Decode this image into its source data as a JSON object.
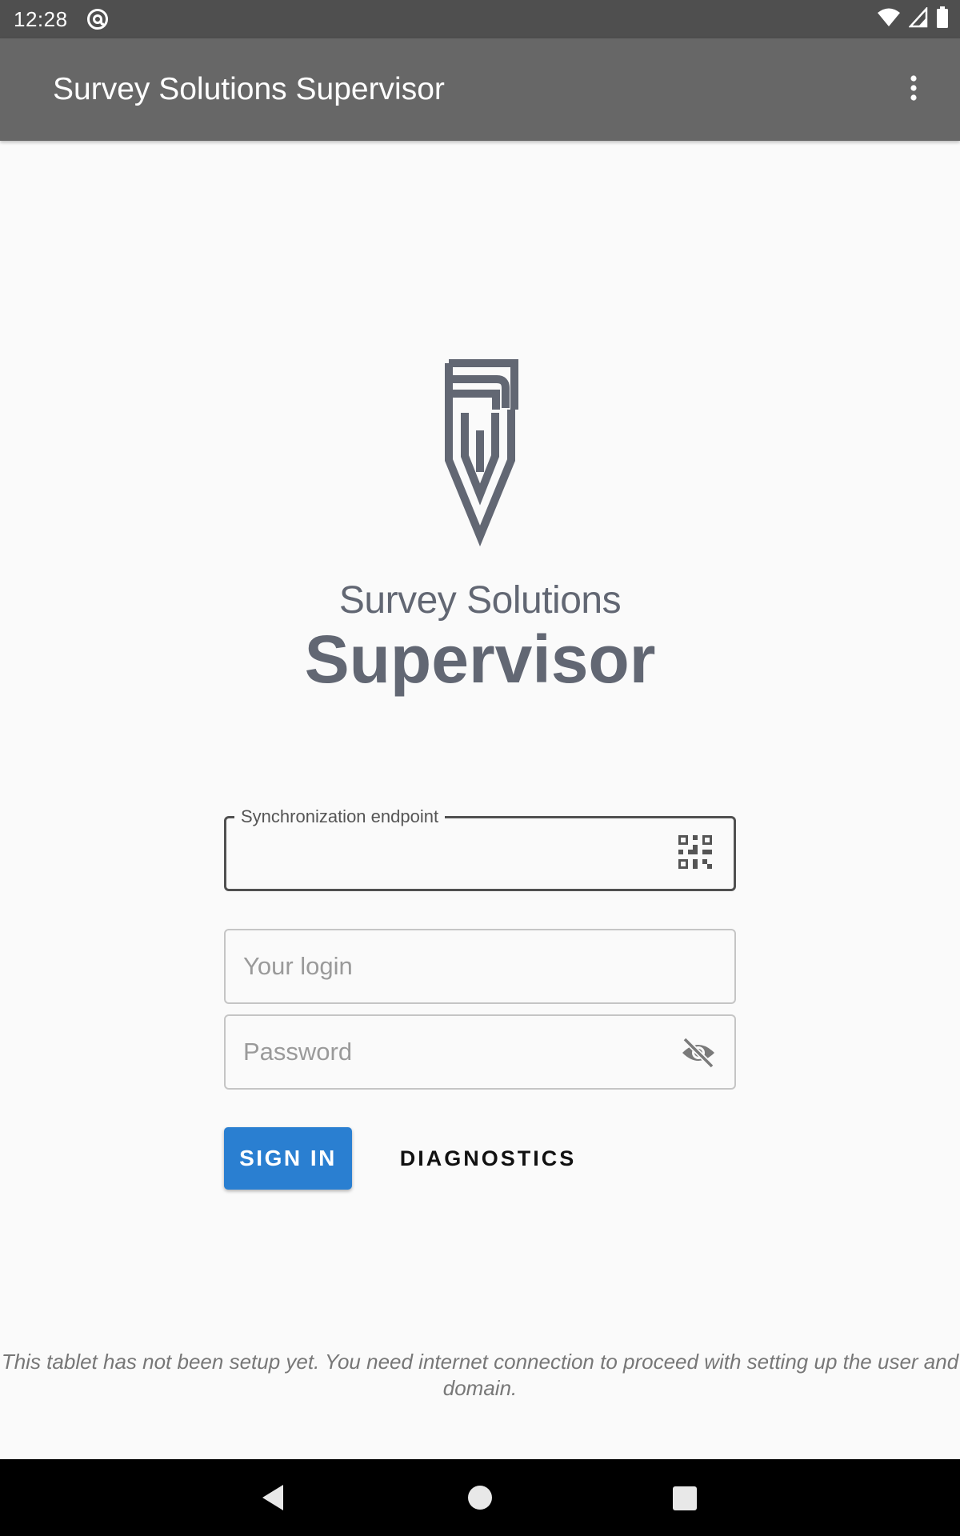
{
  "status_bar": {
    "time": "12:28",
    "left_icon": "at-sign-icon",
    "right_icons": [
      "wifi-icon",
      "cellular-signal-icon",
      "battery-icon"
    ]
  },
  "app_bar": {
    "title": "Survey Solutions Supervisor",
    "menu_icon": "more-vert-icon"
  },
  "logo": {
    "subtitle": "Survey Solutions",
    "title": "Supervisor",
    "color": "#626773"
  },
  "form": {
    "endpoint": {
      "label": "Synchronization endpoint",
      "value": "",
      "icon": "qr-code-icon"
    },
    "login": {
      "placeholder": "Your login",
      "value": ""
    },
    "password": {
      "placeholder": "Password",
      "value": "",
      "icon": "visibility-off-icon"
    }
  },
  "buttons": {
    "sign_in": "SIGN IN",
    "diagnostics": "DIAGNOSTICS"
  },
  "message": "This tablet has not been setup yet. You need internet connection to proceed with setting up the user and domain.",
  "navigation": {
    "icons": [
      "back-icon",
      "home-icon",
      "recents-icon"
    ]
  },
  "colors": {
    "status_bar": "#4f4f4f",
    "app_bar": "#676767",
    "background": "#fafafa",
    "primary_button": "#2a7fd1"
  }
}
